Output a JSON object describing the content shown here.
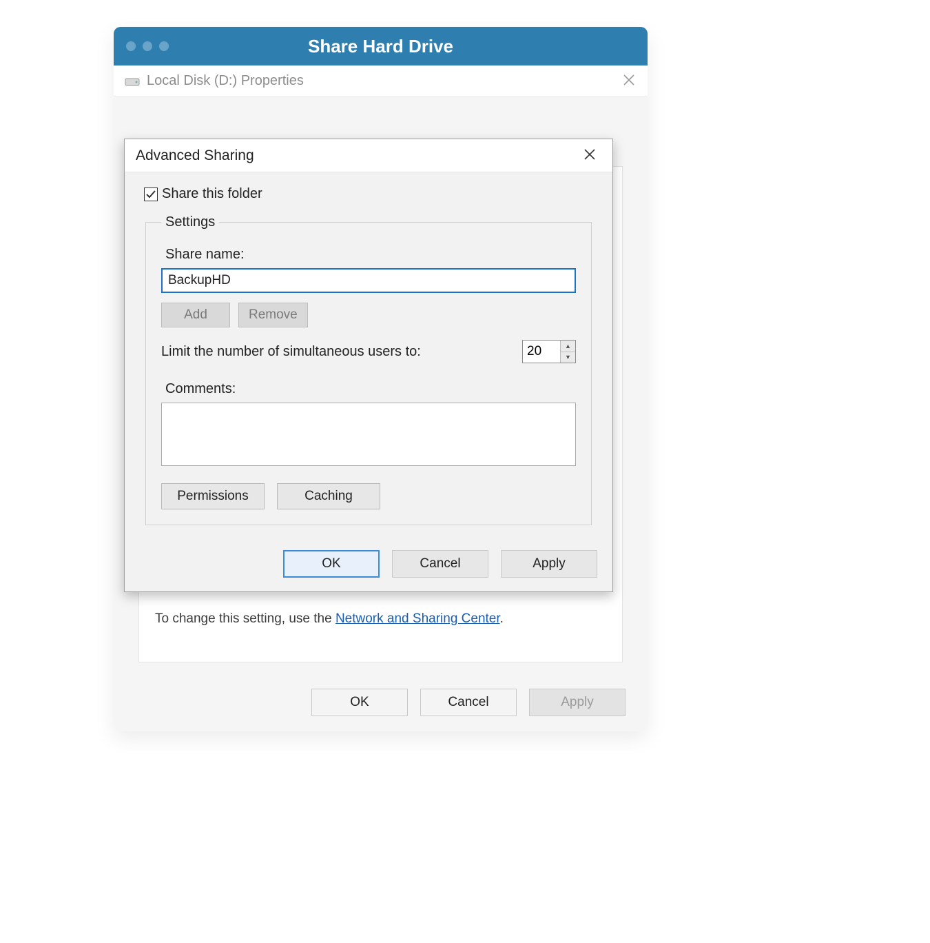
{
  "window": {
    "title": "Share Hard Drive"
  },
  "properties": {
    "title": "Local Disk (D:) Properties",
    "hint_prefix": "To change this setting, use the ",
    "hint_link": "Network and Sharing Center",
    "hint_suffix": ".",
    "buttons": {
      "ok": "OK",
      "cancel": "Cancel",
      "apply": "Apply"
    }
  },
  "modal": {
    "title": "Advanced Sharing",
    "share_checkbox_label": "Share this folder",
    "share_checked": true,
    "settings_legend": "Settings",
    "share_name_label": "Share name:",
    "share_name_value": "BackupHD",
    "add_label": "Add",
    "remove_label": "Remove",
    "limit_label": "Limit the number of simultaneous users to:",
    "limit_value": "20",
    "comments_label": "Comments:",
    "comments_value": "",
    "permissions_label": "Permissions",
    "caching_label": "Caching",
    "buttons": {
      "ok": "OK",
      "cancel": "Cancel",
      "apply": "Apply"
    }
  }
}
